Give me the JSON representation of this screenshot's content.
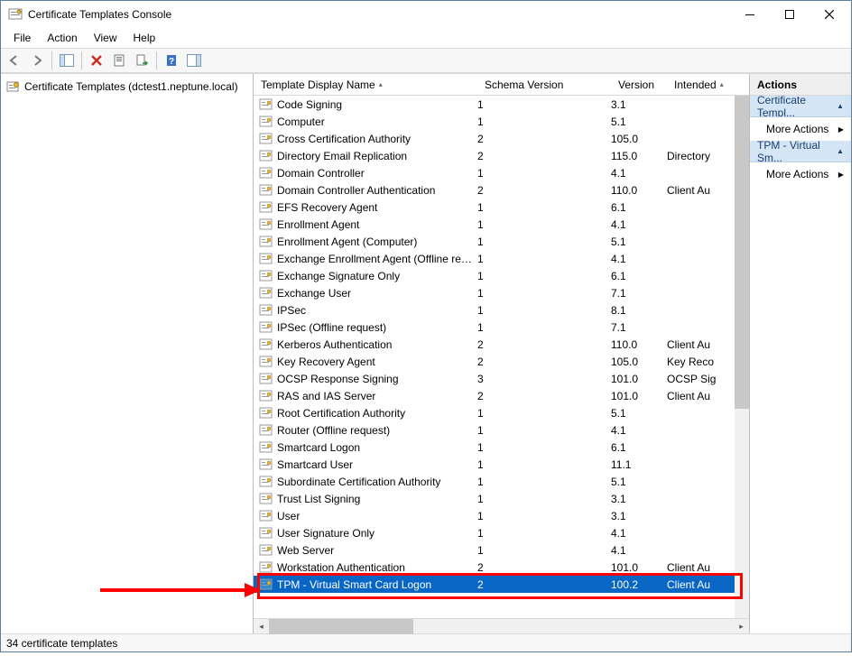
{
  "window": {
    "title": "Certificate Templates Console"
  },
  "menu": {
    "file": "File",
    "action": "Action",
    "view": "View",
    "help": "Help"
  },
  "tree": {
    "root_label": "Certificate Templates (dctest1.neptune.local)"
  },
  "columns": {
    "name": "Template Display Name",
    "schema": "Schema Version",
    "version": "Version",
    "intended": "Intended"
  },
  "templates": [
    {
      "name": "Code Signing",
      "schema": "1",
      "ver": "3.1",
      "int": ""
    },
    {
      "name": "Computer",
      "schema": "1",
      "ver": "5.1",
      "int": ""
    },
    {
      "name": "Cross Certification Authority",
      "schema": "2",
      "ver": "105.0",
      "int": ""
    },
    {
      "name": "Directory Email Replication",
      "schema": "2",
      "ver": "115.0",
      "int": "Directory"
    },
    {
      "name": "Domain Controller",
      "schema": "1",
      "ver": "4.1",
      "int": ""
    },
    {
      "name": "Domain Controller Authentication",
      "schema": "2",
      "ver": "110.0",
      "int": "Client Au"
    },
    {
      "name": "EFS Recovery Agent",
      "schema": "1",
      "ver": "6.1",
      "int": ""
    },
    {
      "name": "Enrollment Agent",
      "schema": "1",
      "ver": "4.1",
      "int": ""
    },
    {
      "name": "Enrollment Agent (Computer)",
      "schema": "1",
      "ver": "5.1",
      "int": ""
    },
    {
      "name": "Exchange Enrollment Agent (Offline requ...",
      "schema": "1",
      "ver": "4.1",
      "int": ""
    },
    {
      "name": "Exchange Signature Only",
      "schema": "1",
      "ver": "6.1",
      "int": ""
    },
    {
      "name": "Exchange User",
      "schema": "1",
      "ver": "7.1",
      "int": ""
    },
    {
      "name": "IPSec",
      "schema": "1",
      "ver": "8.1",
      "int": ""
    },
    {
      "name": "IPSec (Offline request)",
      "schema": "1",
      "ver": "7.1",
      "int": ""
    },
    {
      "name": "Kerberos Authentication",
      "schema": "2",
      "ver": "110.0",
      "int": "Client Au"
    },
    {
      "name": "Key Recovery Agent",
      "schema": "2",
      "ver": "105.0",
      "int": "Key Reco"
    },
    {
      "name": "OCSP Response Signing",
      "schema": "3",
      "ver": "101.0",
      "int": "OCSP Sig"
    },
    {
      "name": "RAS and IAS Server",
      "schema": "2",
      "ver": "101.0",
      "int": "Client Au"
    },
    {
      "name": "Root Certification Authority",
      "schema": "1",
      "ver": "5.1",
      "int": ""
    },
    {
      "name": "Router (Offline request)",
      "schema": "1",
      "ver": "4.1",
      "int": ""
    },
    {
      "name": "Smartcard Logon",
      "schema": "1",
      "ver": "6.1",
      "int": ""
    },
    {
      "name": "Smartcard User",
      "schema": "1",
      "ver": "11.1",
      "int": ""
    },
    {
      "name": "Subordinate Certification Authority",
      "schema": "1",
      "ver": "5.1",
      "int": ""
    },
    {
      "name": "Trust List Signing",
      "schema": "1",
      "ver": "3.1",
      "int": ""
    },
    {
      "name": "User",
      "schema": "1",
      "ver": "3.1",
      "int": ""
    },
    {
      "name": "User Signature Only",
      "schema": "1",
      "ver": "4.1",
      "int": ""
    },
    {
      "name": "Web Server",
      "schema": "1",
      "ver": "4.1",
      "int": ""
    },
    {
      "name": "Workstation Authentication",
      "schema": "2",
      "ver": "101.0",
      "int": "Client Au"
    },
    {
      "name": "TPM - Virtual Smart Card Logon",
      "schema": "2",
      "ver": "100.2",
      "int": "Client Au",
      "selected": true
    }
  ],
  "actions": {
    "header": "Actions",
    "section1": "Certificate Templ...",
    "more1": "More Actions",
    "section2": "TPM - Virtual Sm...",
    "more2": "More Actions"
  },
  "status": "34 certificate templates"
}
